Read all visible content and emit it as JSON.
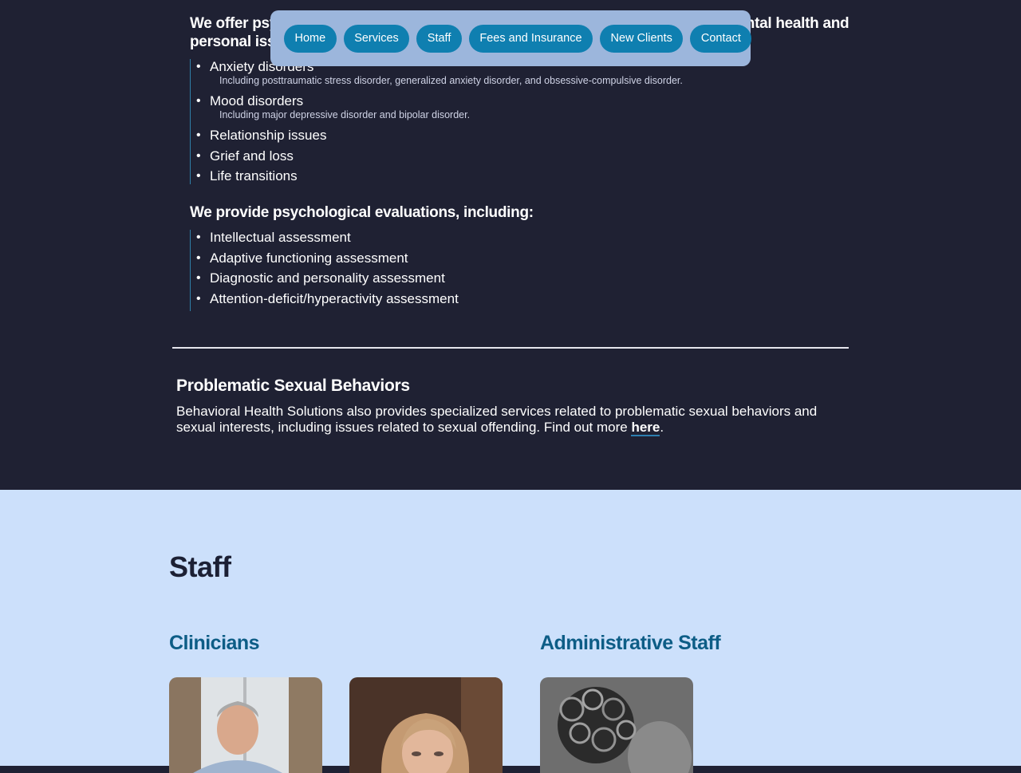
{
  "nav": {
    "items": [
      "Home",
      "Services",
      "Staff",
      "Fees and Insurance",
      "New Clients",
      "Contact"
    ]
  },
  "services": {
    "intro_heading": "We offer psychotherapy for children, adolescents, and adults for a variety of mental health and personal issues, such as:",
    "conditions": [
      {
        "label": "Anxiety disorders",
        "detail": "Including posttraumatic stress disorder, generalized anxiety disorder, and obsessive-compulsive disorder."
      },
      {
        "label": "Mood disorders",
        "detail": "Including major depressive disorder and bipolar disorder."
      },
      {
        "label": "Relationship issues"
      },
      {
        "label": "Grief and loss"
      },
      {
        "label": "Life transitions"
      }
    ],
    "eval_heading": "We provide psychological evaluations, including:",
    "evaluations": [
      "Intellectual assessment",
      "Adaptive functioning assessment",
      "Diagnostic and personality assessment",
      "Attention-deficit/hyperactivity assessment"
    ]
  },
  "psb": {
    "title": "Problematic Sexual Behaviors",
    "text": "Behavioral Health Solutions also provides specialized services related to problematic sexual behaviors and sexual interests, including issues related to sexual offending. Find out more ",
    "link_label": "here",
    "text_end": "."
  },
  "staff": {
    "title": "Staff",
    "clinicians_title": "Clinicians",
    "admin_title": "Administrative Staff"
  },
  "colors": {
    "dark_bg": "#1f2133",
    "light_bg": "#cce0fb",
    "accent": "#0f7fb0",
    "heading_blue": "#0d5d86",
    "nav_bg": "#9cb6dc"
  }
}
